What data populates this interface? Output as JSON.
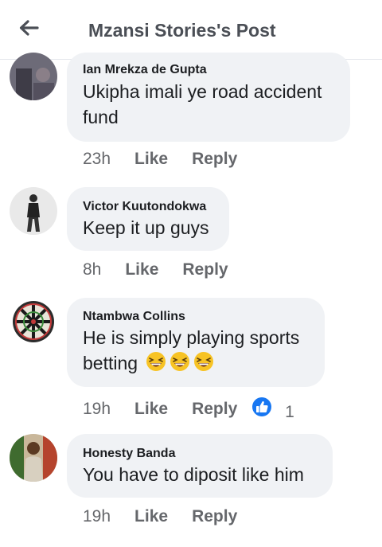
{
  "header": {
    "title": "Mzansi Stories's Post",
    "back_icon": "back-arrow-icon"
  },
  "comments": [
    {
      "author": "Ian Mrekza de Gupta",
      "lines": [
        "Ukipha imali ye road accident",
        "fund"
      ],
      "time": "23h",
      "like": "Like",
      "reply": "Reply"
    },
    {
      "author": "Victor Kuutondokwa",
      "lines": [
        "Keep it up guys"
      ],
      "time": "8h",
      "like": "Like",
      "reply": "Reply"
    },
    {
      "author": "Ntambwa Collins",
      "lines": [
        "He is simply playing sports",
        "betting"
      ],
      "emojis": [
        "grinning-squinting-face",
        "grinning-squinting-face",
        "grinning-squinting-face"
      ],
      "time": "19h",
      "like": "Like",
      "reply": "Reply",
      "reaction": {
        "icon": "like-reaction-icon",
        "count": "1",
        "color": "#1877f2"
      }
    },
    {
      "author": "Honesty Banda",
      "lines": [
        "You have to diposit like him"
      ],
      "time": "19h",
      "like": "Like",
      "reply": "Reply"
    }
  ],
  "colors": {
    "bubble": "#f0f2f5",
    "meta_text": "#65676b",
    "accent": "#1877f2"
  }
}
